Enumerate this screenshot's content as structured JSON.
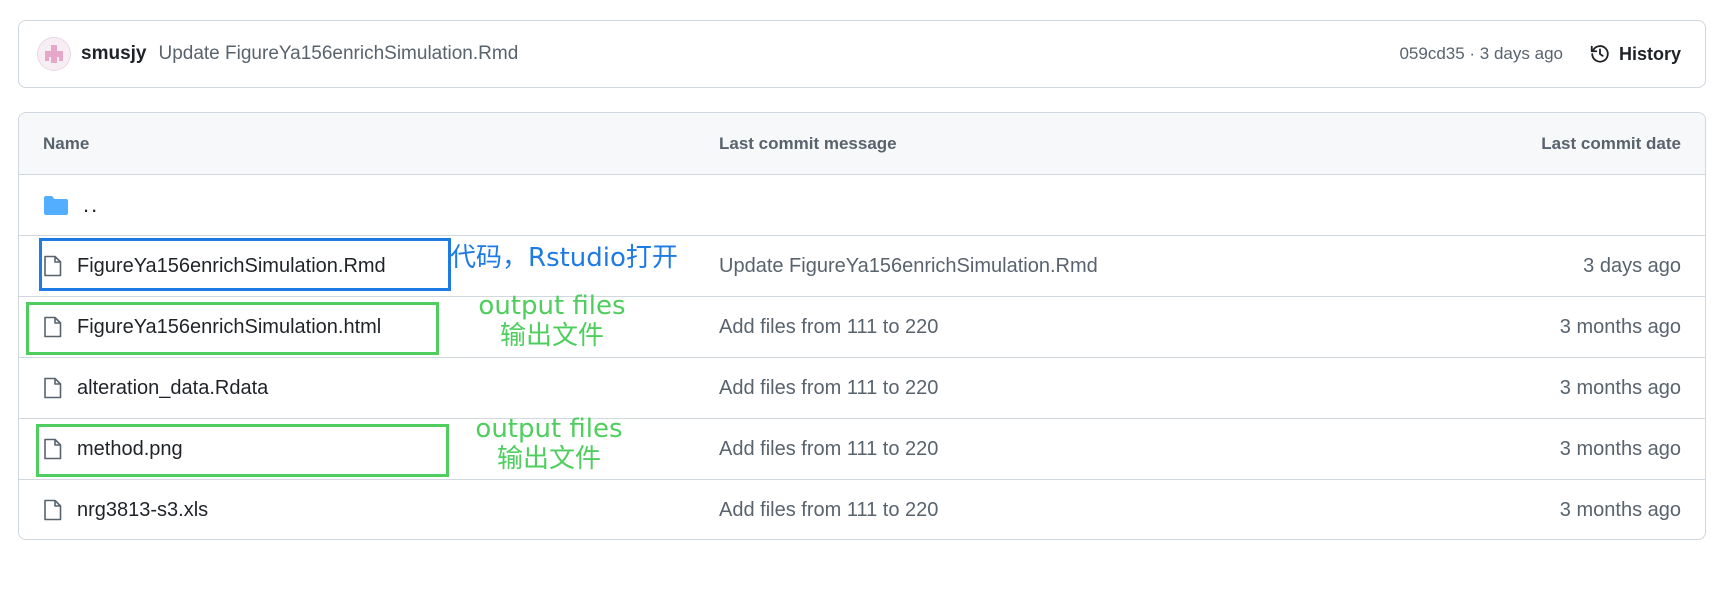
{
  "commit": {
    "author": "smusjy",
    "message": "Update FigureYa156enrichSimulation.Rmd",
    "meta": "059cd35 · 3 days ago",
    "history_label": "History"
  },
  "table": {
    "headers": {
      "name": "Name",
      "message": "Last commit message",
      "date": "Last commit date"
    },
    "parent": "..",
    "rows": [
      {
        "name": "FigureYa156enrichSimulation.Rmd",
        "message": "Update FigureYa156enrichSimulation.Rmd",
        "date": "3 days ago"
      },
      {
        "name": "FigureYa156enrichSimulation.html",
        "message": "Add files from 111 to 220",
        "date": "3 months ago"
      },
      {
        "name": "alteration_data.Rdata",
        "message": "Add files from 111 to 220",
        "date": "3 months ago"
      },
      {
        "name": "method.png",
        "message": "Add files from 111 to 220",
        "date": "3 months ago"
      },
      {
        "name": "nrg3813-s3.xls",
        "message": "Add files from 111 to 220",
        "date": "3 months ago"
      }
    ]
  },
  "annotations": {
    "code_note": "代码，Rstudio打开",
    "output_1_en": "output files",
    "output_1_zh": "输出文件",
    "output_2_en": "output files",
    "output_2_zh": "输出文件"
  },
  "colors": {
    "annotation_blue": "#1f7be4",
    "annotation_green": "#4fce5f",
    "folder": "#54aeff"
  }
}
